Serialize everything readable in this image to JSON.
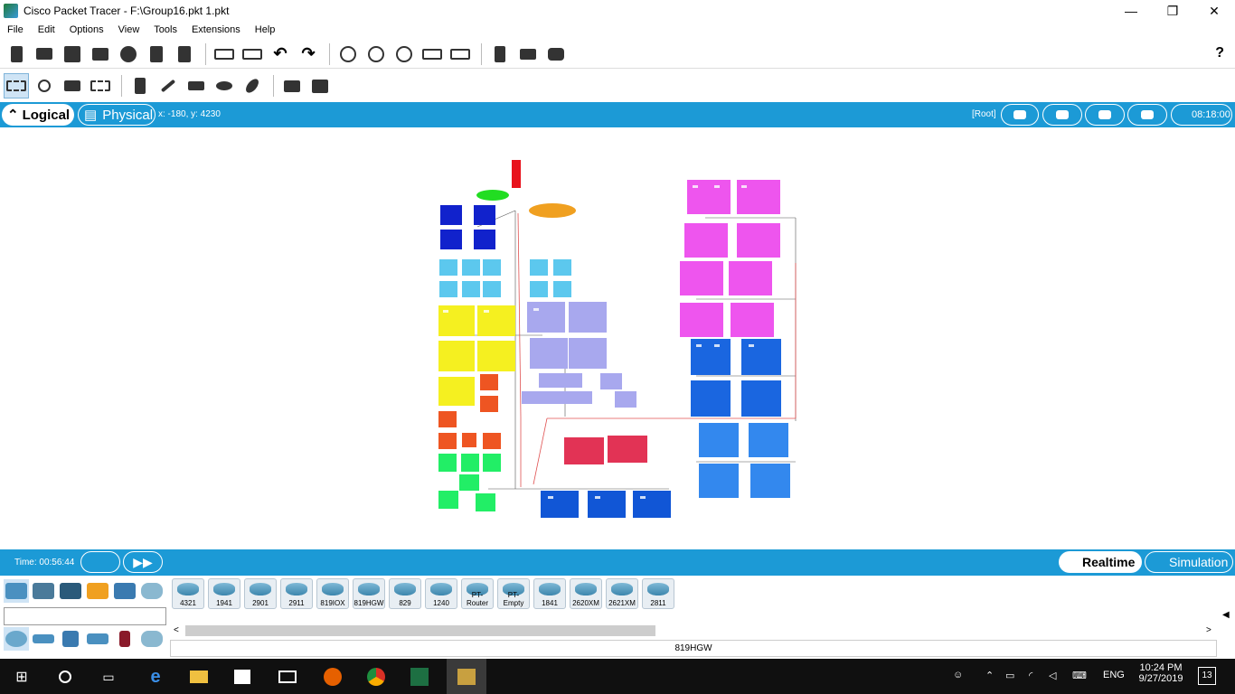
{
  "window": {
    "title": "Cisco Packet Tracer - F:\\Group16.pkt 1.pkt",
    "controls": {
      "minimize": "—",
      "restore": "❐",
      "close": "✕"
    }
  },
  "menu": [
    "File",
    "Edit",
    "Options",
    "View",
    "Tools",
    "Extensions",
    "Help"
  ],
  "toolbar_main": [
    "new-icon",
    "open-icon",
    "save-icon",
    "print-icon",
    "info-icon",
    "network-wizard-icon",
    "activity-wizard-icon",
    "copy-icon",
    "paste-icon",
    "undo-icon",
    "redo-icon",
    "zoom-in-icon",
    "zoom-reset-icon",
    "zoom-out-icon",
    "drawing-palette-icon",
    "custom-device-icon",
    "text-editor-icon",
    "pdu-list-icon",
    "cloud-icon"
  ],
  "help_label": "?",
  "toolbar_tools": [
    "select-icon",
    "inspect-icon",
    "delete-icon",
    "resize-icon",
    "note-icon",
    "line-icon",
    "rectangle-icon",
    "ellipse-icon",
    "freeform-icon",
    "simple-pdu-icon",
    "complex-pdu-icon"
  ],
  "workspace_bar": {
    "logical": "Logical",
    "physical": "Physical",
    "coords": "x: -180, y: 4230",
    "root": "[Root]",
    "time": "08:18:00"
  },
  "status": {
    "time_label": "Time: 00:56:44",
    "realtime": "Realtime",
    "simulation": "Simulation"
  },
  "devices": {
    "routers": [
      "4321",
      "1941",
      "2901",
      "2911",
      "819IOX",
      "819HGW",
      "829",
      "1240",
      "PT-Router",
      "PT-Empty",
      "1841",
      "2620XM",
      "2621XM",
      "2811"
    ],
    "selected_name": "819HGW"
  },
  "taskbar": {
    "lang": "ENG",
    "time": "10:24 PM",
    "date": "9/27/2019",
    "notifications": "13"
  },
  "colors": {
    "accent_blue": "#1c9ad6",
    "zone_magenta": "#ee55ee",
    "zone_dark_blue": "#1156d6",
    "zone_cyan": "#5cc8ee",
    "zone_yellow": "#f5f020",
    "zone_lavender": "#a8a8ee",
    "zone_orange": "#ee5522",
    "zone_green": "#22ee66",
    "zone_red": "#e23355"
  }
}
